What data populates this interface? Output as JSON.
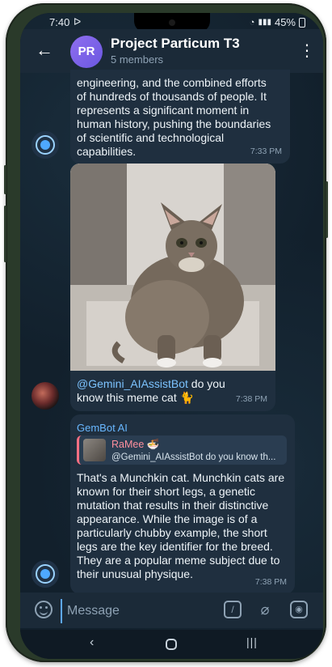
{
  "status": {
    "time": "7:40",
    "notif": "ᐅ",
    "battery": "45%"
  },
  "header": {
    "avatar_initials": "PR",
    "title": "Project Particum T3",
    "subtitle": "5 members"
  },
  "messages": {
    "m1": {
      "text": "engineering, and the combined efforts of hundreds of thousands of people. It represents a significant moment in human history, pushing the boundaries of scientific and technological capabilities.",
      "time": "7:33 PM"
    },
    "m2": {
      "mention": "@Gemini_AIAssistBot",
      "text": " do you know this meme cat 🐈",
      "time": "7:38 PM"
    },
    "m3": {
      "sender": "GemBot AI",
      "reply_name": "RaMee 🍜",
      "reply_snippet": "@Gemini_AIAssistBot do you know th...",
      "text": "That's a Munchkin cat.  Munchkin cats are known for their short legs, a genetic mutation that results in their distinctive appearance.  While the image is of a particularly chubby example, the short legs are the key identifier for the breed.  They are a popular meme subject due to their unusual physique.",
      "time": "7:38 PM"
    }
  },
  "composer": {
    "placeholder": "Message"
  },
  "colors": {
    "accent": "#68b7ff",
    "bubble": "#1f2f3f",
    "reply_bar": "#ff6f83"
  }
}
